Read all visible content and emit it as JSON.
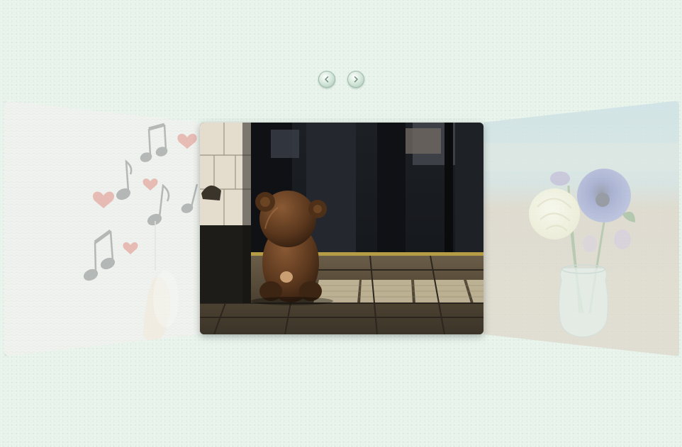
{
  "carousel": {
    "prev_icon": "chevron-left-icon",
    "next_icon": "chevron-right-icon",
    "accent_color": "#9fbca9",
    "slides": [
      {
        "position": "left",
        "subject": "music-notes-hearts-photo"
      },
      {
        "position": "center",
        "subject": "teddy-bear-photo"
      },
      {
        "position": "right",
        "subject": "flowers-in-vase-photo"
      }
    ]
  }
}
